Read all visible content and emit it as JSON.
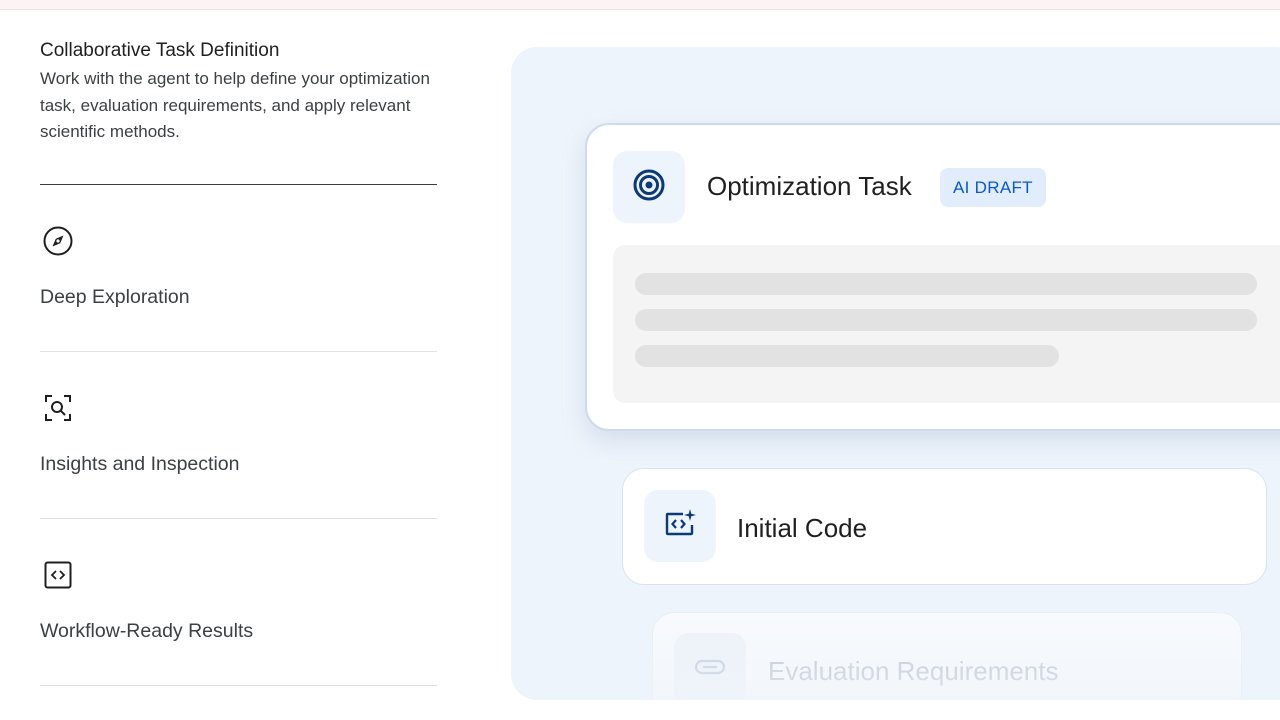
{
  "features": {
    "active": {
      "title": "Collaborative Task Definition",
      "description": "Work with the agent to help define your optimization task, evaluation requirements, and apply relevant scientific methods."
    },
    "items": [
      {
        "label": "Deep Exploration",
        "icon": "compass-icon"
      },
      {
        "label": "Insights and Inspection",
        "icon": "scan-search-icon"
      },
      {
        "label": "Workflow-Ready Results",
        "icon": "code-box-icon"
      }
    ]
  },
  "panel": {
    "optimization_card": {
      "title": "Optimization Task",
      "badge": "AI DRAFT",
      "icon": "target-icon"
    },
    "code_card": {
      "title": "Initial Code",
      "icon": "code-sparkle-icon"
    },
    "eval_card": {
      "title": "Evaluation Requirements",
      "icon": "toggle-icon"
    }
  },
  "colors": {
    "accent": "#0b57d0",
    "icon_dark": "#0b3a7a",
    "panel_bg": "#eef4fb",
    "badge_bg": "#e1edfb"
  }
}
